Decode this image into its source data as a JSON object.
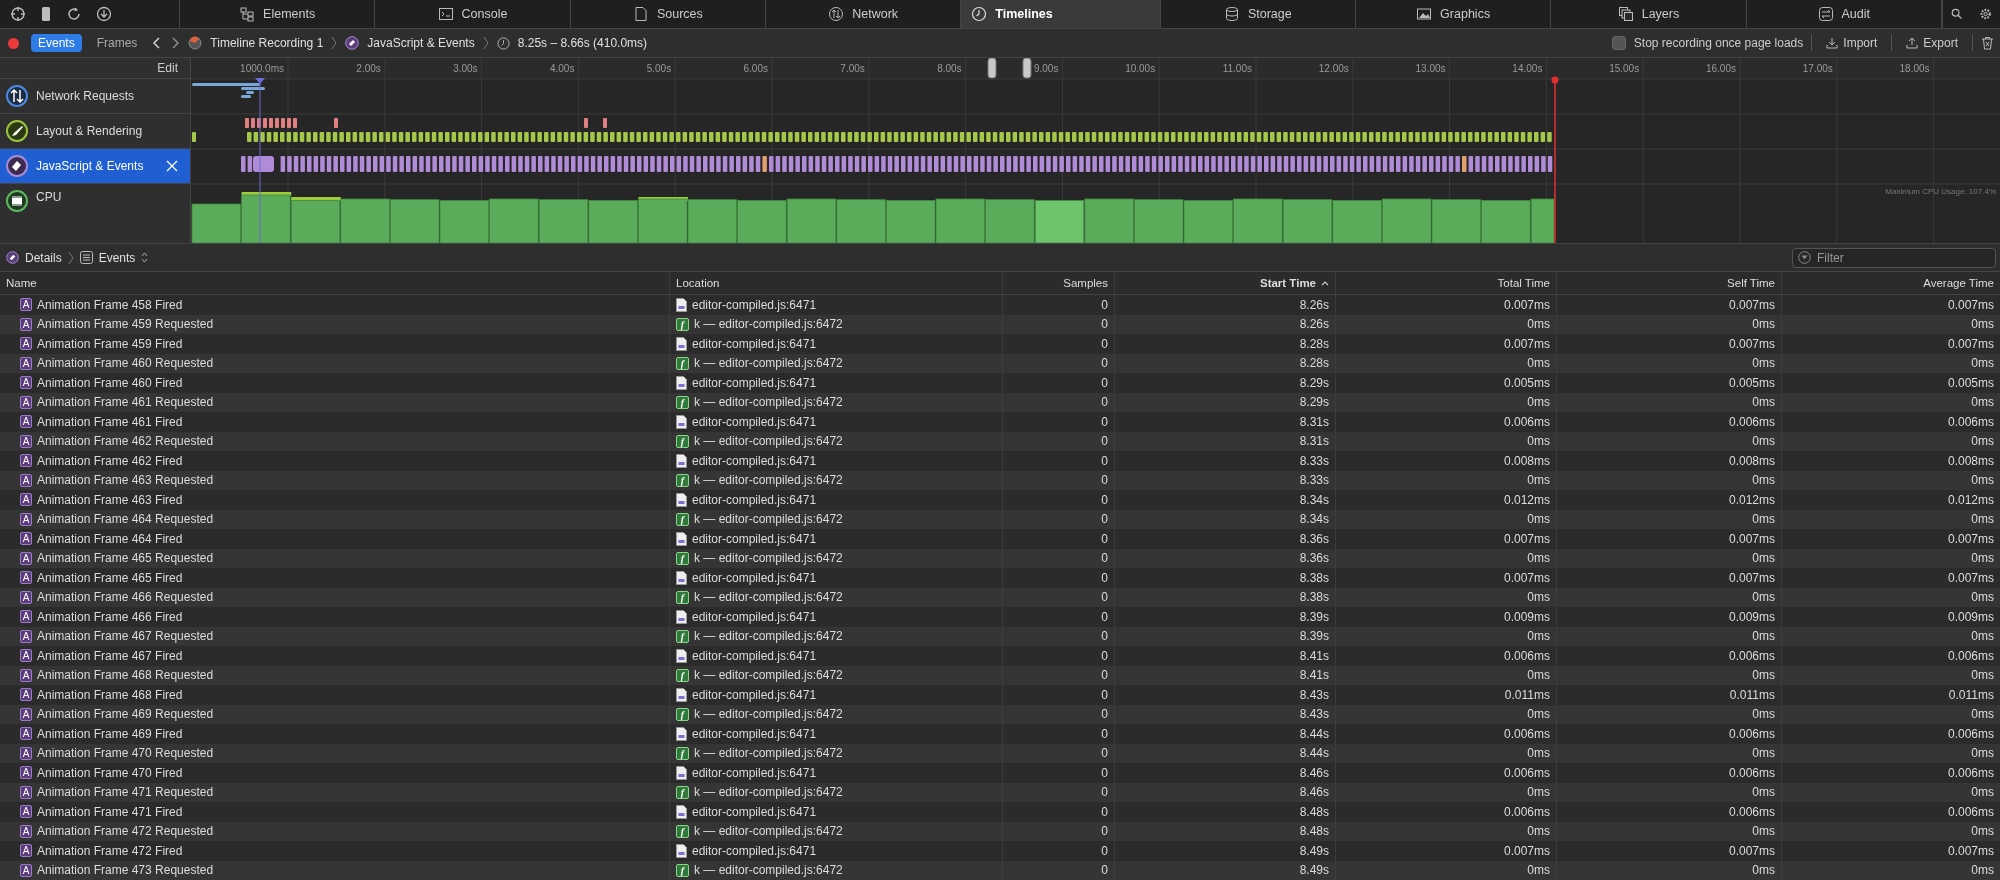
{
  "tabs": [
    {
      "label": "Elements",
      "selected": false
    },
    {
      "label": "Console",
      "selected": false
    },
    {
      "label": "Sources",
      "selected": false
    },
    {
      "label": "Network",
      "selected": false
    },
    {
      "label": "Timelines",
      "selected": true
    },
    {
      "label": "Storage",
      "selected": false
    },
    {
      "label": "Graphics",
      "selected": false
    },
    {
      "label": "Layers",
      "selected": false
    },
    {
      "label": "Audit",
      "selected": false
    }
  ],
  "toolbar": {
    "recording": true,
    "modes": [
      {
        "label": "Events",
        "selected": true
      },
      {
        "label": "Frames",
        "selected": false
      }
    ],
    "breadcrumb": [
      "Timeline Recording 1",
      "JavaScript & Events",
      "8.25s – 8.66s (410.0ms)"
    ],
    "stop_recording": {
      "label": "Stop recording once page loads",
      "checked": false
    },
    "import": "Import",
    "export": "Export"
  },
  "timeline": {
    "edit": "Edit",
    "ruler": [
      "1000.0ms",
      "2.00s",
      "3.00s",
      "4.00s",
      "5.00s",
      "6.00s",
      "7.00s",
      "8.00s",
      "9.00s",
      "10.00s",
      "11.00s",
      "12.00s",
      "13.00s",
      "14.00s",
      "15.00s",
      "16.00s",
      "17.00s",
      "18.00s"
    ],
    "tracks": [
      {
        "kind": "network",
        "name": "Network Requests",
        "selected": false
      },
      {
        "kind": "layout",
        "name": "Layout & Rendering",
        "selected": false
      },
      {
        "kind": "script",
        "name": "JavaScript & Events",
        "selected": true
      },
      {
        "kind": "cpu",
        "name": "CPU",
        "selected": false
      }
    ],
    "cpu_max": "Maximum CPU Usage: 107.4%"
  },
  "details_bar": {
    "breadcrumb": [
      "Details",
      "Events"
    ],
    "filter": {
      "placeholder": "Filter"
    }
  },
  "table": {
    "columns": [
      {
        "label": "Name",
        "sorted": false
      },
      {
        "label": "Location",
        "sorted": false
      },
      {
        "label": "Samples",
        "sorted": false
      },
      {
        "label": "Start Time",
        "sorted": true
      },
      {
        "label": "Total Time",
        "sorted": false
      },
      {
        "label": "Self Time",
        "sorted": false
      },
      {
        "label": "Average Time",
        "sorted": false
      }
    ],
    "rows": [
      {
        "badge": "A",
        "name": "Animation Frame 458 Fired",
        "location": {
          "kind": "file",
          "text": "editor-compiled.js:6471"
        },
        "samples": "0",
        "start": "8.26s",
        "total": "0.007ms",
        "self": "0.007ms",
        "average": "0.007ms"
      },
      {
        "badge": "A",
        "name": "Animation Frame 459 Requested",
        "location": {
          "kind": "function",
          "badge": "f",
          "text": "k — editor-compiled.js:6472"
        },
        "samples": "0",
        "start": "8.26s",
        "total": "0ms",
        "self": "0ms",
        "average": "0ms"
      },
      {
        "badge": "A",
        "name": "Animation Frame 459 Fired",
        "location": {
          "kind": "file",
          "text": "editor-compiled.js:6471"
        },
        "samples": "0",
        "start": "8.28s",
        "total": "0.007ms",
        "self": "0.007ms",
        "average": "0.007ms"
      },
      {
        "badge": "A",
        "name": "Animation Frame 460 Requested",
        "location": {
          "kind": "function",
          "badge": "f",
          "text": "k — editor-compiled.js:6472"
        },
        "samples": "0",
        "start": "8.28s",
        "total": "0ms",
        "self": "0ms",
        "average": "0ms"
      },
      {
        "badge": "A",
        "name": "Animation Frame 460 Fired",
        "location": {
          "kind": "file",
          "text": "editor-compiled.js:6471"
        },
        "samples": "0",
        "start": "8.29s",
        "total": "0.005ms",
        "self": "0.005ms",
        "average": "0.005ms"
      },
      {
        "badge": "A",
        "name": "Animation Frame 461 Requested",
        "location": {
          "kind": "function",
          "badge": "f",
          "text": "k — editor-compiled.js:6472"
        },
        "samples": "0",
        "start": "8.29s",
        "total": "0ms",
        "self": "0ms",
        "average": "0ms"
      },
      {
        "badge": "A",
        "name": "Animation Frame 461 Fired",
        "location": {
          "kind": "file",
          "text": "editor-compiled.js:6471"
        },
        "samples": "0",
        "start": "8.31s",
        "total": "0.006ms",
        "self": "0.006ms",
        "average": "0.006ms"
      },
      {
        "badge": "A",
        "name": "Animation Frame 462 Requested",
        "location": {
          "kind": "function",
          "badge": "f",
          "text": "k — editor-compiled.js:6472"
        },
        "samples": "0",
        "start": "8.31s",
        "total": "0ms",
        "self": "0ms",
        "average": "0ms"
      },
      {
        "badge": "A",
        "name": "Animation Frame 462 Fired",
        "location": {
          "kind": "file",
          "text": "editor-compiled.js:6471"
        },
        "samples": "0",
        "start": "8.33s",
        "total": "0.008ms",
        "self": "0.008ms",
        "average": "0.008ms"
      },
      {
        "badge": "A",
        "name": "Animation Frame 463 Requested",
        "location": {
          "kind": "function",
          "badge": "f",
          "text": "k — editor-compiled.js:6472"
        },
        "samples": "0",
        "start": "8.33s",
        "total": "0ms",
        "self": "0ms",
        "average": "0ms"
      },
      {
        "badge": "A",
        "name": "Animation Frame 463 Fired",
        "location": {
          "kind": "file",
          "text": "editor-compiled.js:6471"
        },
        "samples": "0",
        "start": "8.34s",
        "total": "0.012ms",
        "self": "0.012ms",
        "average": "0.012ms"
      },
      {
        "badge": "A",
        "name": "Animation Frame 464 Requested",
        "location": {
          "kind": "function",
          "badge": "f",
          "text": "k — editor-compiled.js:6472"
        },
        "samples": "0",
        "start": "8.34s",
        "total": "0ms",
        "self": "0ms",
        "average": "0ms"
      },
      {
        "badge": "A",
        "name": "Animation Frame 464 Fired",
        "location": {
          "kind": "file",
          "text": "editor-compiled.js:6471"
        },
        "samples": "0",
        "start": "8.36s",
        "total": "0.007ms",
        "self": "0.007ms",
        "average": "0.007ms"
      },
      {
        "badge": "A",
        "name": "Animation Frame 465 Requested",
        "location": {
          "kind": "function",
          "badge": "f",
          "text": "k — editor-compiled.js:6472"
        },
        "samples": "0",
        "start": "8.36s",
        "total": "0ms",
        "self": "0ms",
        "average": "0ms"
      },
      {
        "badge": "A",
        "name": "Animation Frame 465 Fired",
        "location": {
          "kind": "file",
          "text": "editor-compiled.js:6471"
        },
        "samples": "0",
        "start": "8.38s",
        "total": "0.007ms",
        "self": "0.007ms",
        "average": "0.007ms"
      },
      {
        "badge": "A",
        "name": "Animation Frame 466 Requested",
        "location": {
          "kind": "function",
          "badge": "f",
          "text": "k — editor-compiled.js:6472"
        },
        "samples": "0",
        "start": "8.38s",
        "total": "0ms",
        "self": "0ms",
        "average": "0ms"
      },
      {
        "badge": "A",
        "name": "Animation Frame 466 Fired",
        "location": {
          "kind": "file",
          "text": "editor-compiled.js:6471"
        },
        "samples": "0",
        "start": "8.39s",
        "total": "0.009ms",
        "self": "0.009ms",
        "average": "0.009ms"
      },
      {
        "badge": "A",
        "name": "Animation Frame 467 Requested",
        "location": {
          "kind": "function",
          "badge": "f",
          "text": "k — editor-compiled.js:6472"
        },
        "samples": "0",
        "start": "8.39s",
        "total": "0ms",
        "self": "0ms",
        "average": "0ms"
      },
      {
        "badge": "A",
        "name": "Animation Frame 467 Fired",
        "location": {
          "kind": "file",
          "text": "editor-compiled.js:6471"
        },
        "samples": "0",
        "start": "8.41s",
        "total": "0.006ms",
        "self": "0.006ms",
        "average": "0.006ms"
      },
      {
        "badge": "A",
        "name": "Animation Frame 468 Requested",
        "location": {
          "kind": "function",
          "badge": "f",
          "text": "k — editor-compiled.js:6472"
        },
        "samples": "0",
        "start": "8.41s",
        "total": "0ms",
        "self": "0ms",
        "average": "0ms"
      },
      {
        "badge": "A",
        "name": "Animation Frame 468 Fired",
        "location": {
          "kind": "file",
          "text": "editor-compiled.js:6471"
        },
        "samples": "0",
        "start": "8.43s",
        "total": "0.011ms",
        "self": "0.011ms",
        "average": "0.011ms"
      },
      {
        "badge": "A",
        "name": "Animation Frame 469 Requested",
        "location": {
          "kind": "function",
          "badge": "f",
          "text": "k — editor-compiled.js:6472"
        },
        "samples": "0",
        "start": "8.43s",
        "total": "0ms",
        "self": "0ms",
        "average": "0ms"
      },
      {
        "badge": "A",
        "name": "Animation Frame 469 Fired",
        "location": {
          "kind": "file",
          "text": "editor-compiled.js:6471"
        },
        "samples": "0",
        "start": "8.44s",
        "total": "0.006ms",
        "self": "0.006ms",
        "average": "0.006ms"
      },
      {
        "badge": "A",
        "name": "Animation Frame 470 Requested",
        "location": {
          "kind": "function",
          "badge": "f",
          "text": "k — editor-compiled.js:6472"
        },
        "samples": "0",
        "start": "8.44s",
        "total": "0ms",
        "self": "0ms",
        "average": "0ms"
      },
      {
        "badge": "A",
        "name": "Animation Frame 470 Fired",
        "location": {
          "kind": "file",
          "text": "editor-compiled.js:6471"
        },
        "samples": "0",
        "start": "8.46s",
        "total": "0.006ms",
        "self": "0.006ms",
        "average": "0.006ms"
      },
      {
        "badge": "A",
        "name": "Animation Frame 471 Requested",
        "location": {
          "kind": "function",
          "badge": "f",
          "text": "k — editor-compiled.js:6472"
        },
        "samples": "0",
        "start": "8.46s",
        "total": "0ms",
        "self": "0ms",
        "average": "0ms"
      },
      {
        "badge": "A",
        "name": "Animation Frame 471 Fired",
        "location": {
          "kind": "file",
          "text": "editor-compiled.js:6471"
        },
        "samples": "0",
        "start": "8.48s",
        "total": "0.006ms",
        "self": "0.006ms",
        "average": "0.006ms"
      },
      {
        "badge": "A",
        "name": "Animation Frame 472 Requested",
        "location": {
          "kind": "function",
          "badge": "f",
          "text": "k — editor-compiled.js:6472"
        },
        "samples": "0",
        "start": "8.48s",
        "total": "0ms",
        "self": "0ms",
        "average": "0ms"
      },
      {
        "badge": "A",
        "name": "Animation Frame 472 Fired",
        "location": {
          "kind": "file",
          "text": "editor-compiled.js:6471"
        },
        "samples": "0",
        "start": "8.49s",
        "total": "0.007ms",
        "self": "0.007ms",
        "average": "0.007ms"
      },
      {
        "badge": "A",
        "name": "Animation Frame 473 Requested",
        "location": {
          "kind": "function",
          "badge": "f",
          "text": "k — editor-compiled.js:6472"
        },
        "samples": "0",
        "start": "8.49s",
        "total": "0ms",
        "self": "0ms",
        "average": "0ms"
      }
    ]
  }
}
